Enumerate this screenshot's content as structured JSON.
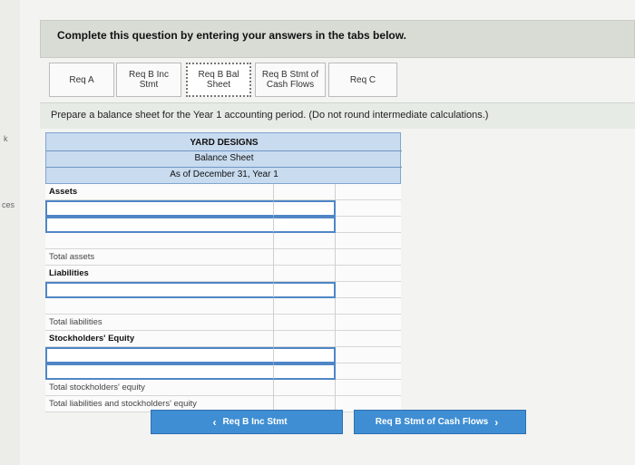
{
  "header": {
    "text": "Complete this question by entering your answers in the tabs below."
  },
  "left_fragments": {
    "k": "k",
    "ces": "ces"
  },
  "tabs": [
    {
      "line1": "Req A",
      "line2": ""
    },
    {
      "line1": "Req B Inc",
      "line2": "Stmt"
    },
    {
      "line1": "Req B Bal",
      "line2": "Sheet"
    },
    {
      "line1": "Req B Stmt of",
      "line2": "Cash Flows"
    },
    {
      "line1": "Req C",
      "line2": ""
    }
  ],
  "active_tab": "Req B Bal Sheet",
  "instruction": "Prepare a balance sheet for the Year 1 accounting period. (Do not round intermediate calculations.)",
  "sheet": {
    "company": "YARD DESIGNS",
    "title": "Balance Sheet",
    "date": "As of December 31, Year 1",
    "assets_label": "Assets",
    "total_assets": "Total assets",
    "liabilities_label": "Liabilities",
    "total_liabilities": "Total liabilities",
    "equity_label": "Stockholders' Equity",
    "total_equity": "Total stockholders' equity",
    "total_liab_equity": "Total liabilities and stockholders' equity"
  },
  "nav": {
    "prev_label": "Req B Inc Stmt",
    "next_label": "Req B Stmt of Cash Flows",
    "prev_icon": "chevron-left-icon",
    "next_icon": "chevron-right-icon"
  },
  "colors": {
    "accent": "#3f8ed3",
    "sheet_header": "#c8dbef"
  }
}
